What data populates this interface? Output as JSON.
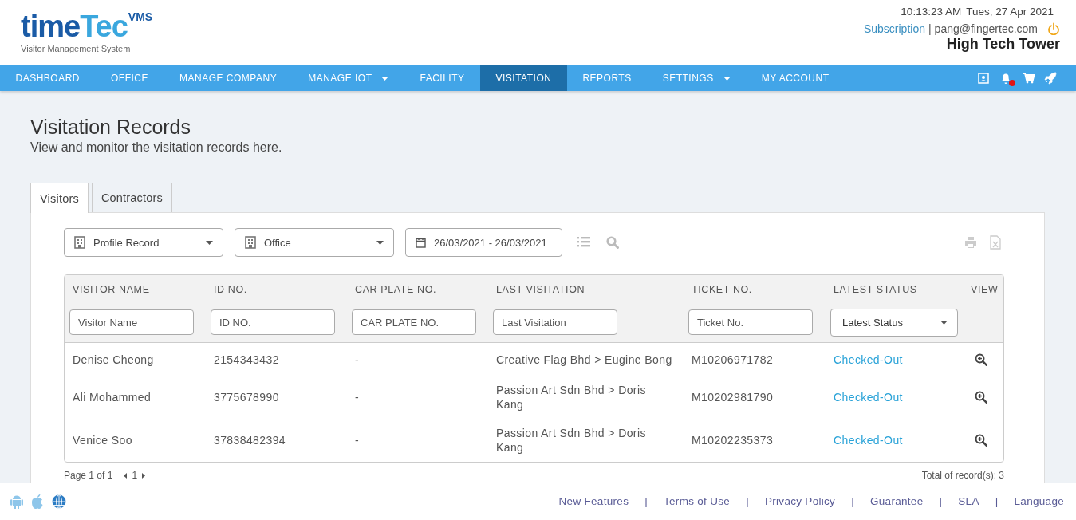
{
  "header": {
    "logo": {
      "brand_dark": "time",
      "brand_light": "Tec",
      "badge": "VMS",
      "tagline": "Visitor Management System"
    },
    "time": "10:13:23 AM",
    "date": "Tues, 27 Apr 2021",
    "subscription_link": "Subscription",
    "separator": "|",
    "user_email": "pang@fingertec.com",
    "building": "High Tech Tower"
  },
  "nav": {
    "items": [
      {
        "label": "DASHBOARD",
        "selected": false,
        "dropdown": false
      },
      {
        "label": "OFFICE",
        "selected": false,
        "dropdown": false
      },
      {
        "label": "MANAGE COMPANY",
        "selected": false,
        "dropdown": false
      },
      {
        "label": "MANAGE IOT",
        "selected": false,
        "dropdown": true
      },
      {
        "label": "FACILITY",
        "selected": false,
        "dropdown": false
      },
      {
        "label": "VISITATION",
        "selected": true,
        "dropdown": false
      },
      {
        "label": "REPORTS",
        "selected": false,
        "dropdown": false
      },
      {
        "label": "SETTINGS",
        "selected": false,
        "dropdown": true
      },
      {
        "label": "MY ACCOUNT",
        "selected": false,
        "dropdown": false
      }
    ],
    "notification_dot": true
  },
  "page": {
    "title": "Visitation Records",
    "subtitle": "View and monitor the visitation records here."
  },
  "tabs": [
    {
      "label": "Visitors",
      "selected": true
    },
    {
      "label": "Contractors",
      "selected": false
    }
  ],
  "filters": {
    "profile": "Profile Record",
    "office": "Office",
    "date_range": "26/03/2021 - 26/03/2021"
  },
  "table": {
    "columns": [
      "VISITOR NAME",
      "ID NO.",
      "CAR PLATE NO.",
      "LAST VISITATION",
      "TICKET NO.",
      "LATEST STATUS",
      "VIEW"
    ],
    "column_filters": [
      {
        "kind": "text",
        "placeholder": "Visitor Name"
      },
      {
        "kind": "text",
        "placeholder": "ID NO."
      },
      {
        "kind": "text",
        "placeholder": "CAR PLATE NO."
      },
      {
        "kind": "text",
        "placeholder": "Last Visitation"
      },
      {
        "kind": "text",
        "placeholder": "Ticket No."
      },
      {
        "kind": "select",
        "value": "Latest Status"
      },
      {
        "kind": "none"
      }
    ],
    "rows": [
      {
        "name": "Denise Cheong",
        "id_no": "2154343432",
        "car_plate": "-",
        "last_visitation": "Creative Flag Bhd > Eugine Bong",
        "ticket_no": "M10206971782",
        "status": "Checked-Out"
      },
      {
        "name": "Ali Mohammed",
        "id_no": "3775678990",
        "car_plate": "-",
        "last_visitation": "Passion Art Sdn Bhd > Doris Kang",
        "ticket_no": "M10202981790",
        "status": "Checked-Out"
      },
      {
        "name": "Venice Soo",
        "id_no": "37838482394",
        "car_plate": "-",
        "last_visitation": "Passion Art Sdn Bhd > Doris Kang",
        "ticket_no": "M10202235373",
        "status": "Checked-Out"
      }
    ]
  },
  "pagination": {
    "page_label": "Page 1 of 1",
    "current_page": "1",
    "total": "Total of record(s): 3"
  },
  "footer": {
    "links": [
      "New Features",
      "Terms of Use",
      "Privacy Policy",
      "Guarantee",
      "SLA",
      "Language"
    ],
    "separator": "|"
  }
}
